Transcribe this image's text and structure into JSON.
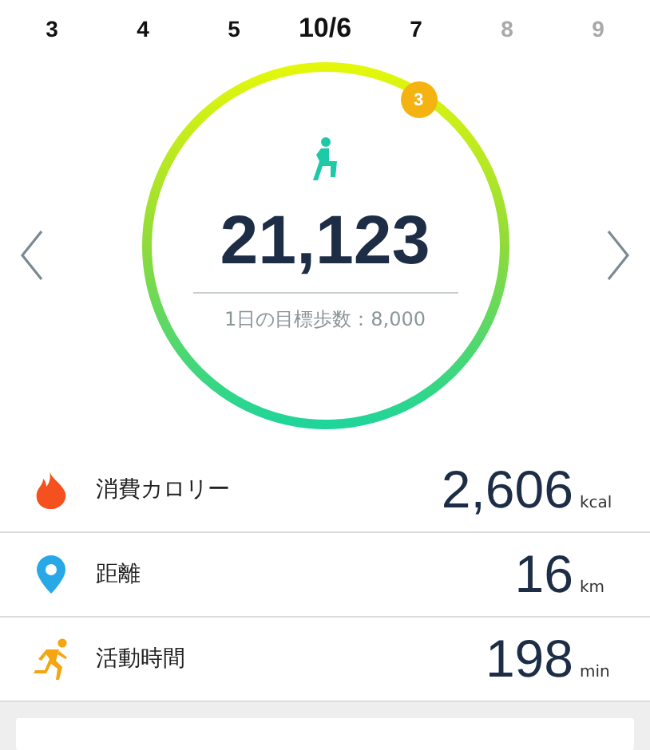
{
  "dates": [
    {
      "label": "3",
      "selected": false,
      "disabled": false
    },
    {
      "label": "4",
      "selected": false,
      "disabled": false
    },
    {
      "label": "5",
      "selected": false,
      "disabled": false
    },
    {
      "label": "10/6",
      "selected": true,
      "disabled": false
    },
    {
      "label": "7",
      "selected": false,
      "disabled": false
    },
    {
      "label": "8",
      "selected": false,
      "disabled": true
    },
    {
      "label": "9",
      "selected": false,
      "disabled": true
    }
  ],
  "steps": {
    "badge": "3",
    "count": "21,123",
    "goal": "1日の目標歩数：8,000"
  },
  "stats": [
    {
      "kind": "fire",
      "label": "消費カロリー",
      "value": "2,606",
      "unit": "kcal"
    },
    {
      "kind": "pin",
      "label": "距離",
      "value": "16",
      "unit": "km"
    },
    {
      "kind": "runner",
      "label": "活動時間",
      "value": "198",
      "unit": "min"
    }
  ]
}
